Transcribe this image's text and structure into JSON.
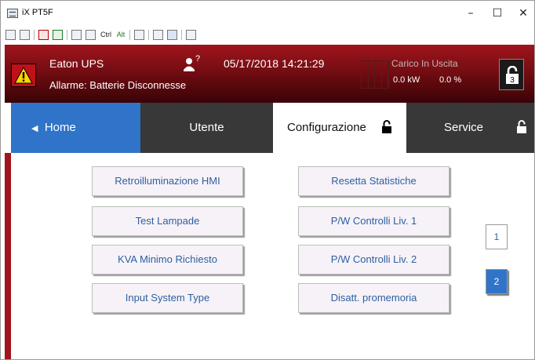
{
  "window": {
    "title": "iX PT5F",
    "controls": {
      "minimize": "–",
      "maximize": "☐",
      "close": "✕"
    }
  },
  "toolbar": {
    "ctrl_label": "Ctrl",
    "alt_label": "Alt"
  },
  "header": {
    "device_name": "Eaton UPS",
    "alarm_text": "Allarme: Batterie Disconnesse",
    "user_level": "?",
    "datetime": "05/17/2018 14:21:29",
    "load_title": "Carico In Uscita",
    "load_kw": "0.0 kW",
    "load_percent": "0.0 %",
    "lock_level": "3",
    "colors": {
      "band_top": "#a0141c",
      "band_bottom": "#3a0306",
      "alarm_yellow": "#ffd400"
    }
  },
  "tabs": {
    "home": "Home",
    "utente": "Utente",
    "configurazione": "Configurazione",
    "service": "Service",
    "active": "Configurazione",
    "colors": {
      "home": "#2f74c8",
      "inactive": "#383838",
      "active": "#ffffff"
    }
  },
  "buttons": {
    "left": [
      "Retroilluminazione HMI",
      "Test Lampade",
      "KVA Minimo Richiesto",
      "Input System Type"
    ],
    "right": [
      "Resetta Statistiche",
      "P/W Controlli Liv. 1",
      "P/W Controlli Liv. 2",
      "Disatt. promemoria"
    ]
  },
  "pagination": {
    "pages": [
      "1",
      "2"
    ],
    "current": "2"
  }
}
